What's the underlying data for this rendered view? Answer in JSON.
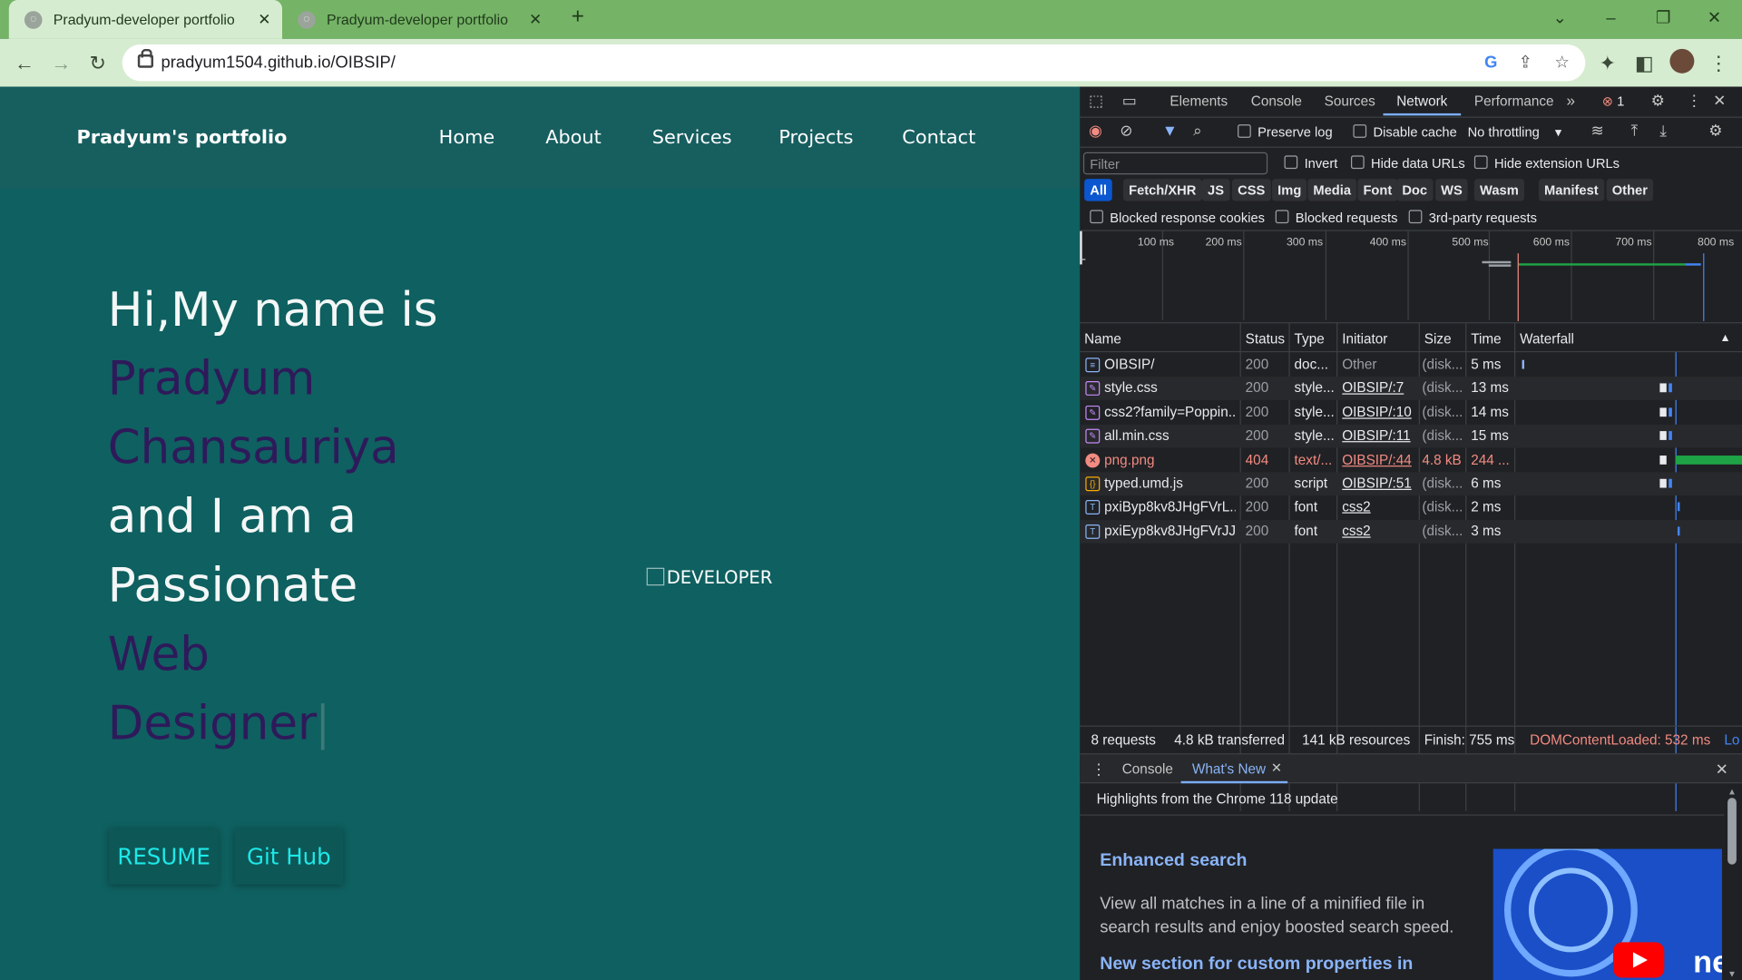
{
  "browser": {
    "tabs": [
      {
        "title": "Pradyum-developer portfolio"
      },
      {
        "title": "Pradyum-developer portfolio"
      }
    ],
    "url": "pradyum1504.github.io/OIBSIP/",
    "new_tab_label": "+"
  },
  "page": {
    "brand": "Pradyum's portfolio",
    "nav": [
      "Home",
      "About",
      "Services",
      "Projects",
      "Contact"
    ],
    "hero_lines": [
      {
        "text": "Hi,My name is",
        "color": "#f4f7f7"
      },
      {
        "text": "Pradyum",
        "color": "#2e1a5a"
      },
      {
        "text": "Chansauriya",
        "color": "#2e1a5a"
      },
      {
        "text": "and I am a",
        "color": "#f4f7f7"
      },
      {
        "text": "Passionate",
        "color": "#f4f7f7"
      },
      {
        "text": "Web",
        "color": "#2e1a5a"
      },
      {
        "text": "Designer",
        "color": "#2e1a5a"
      }
    ],
    "image_alt": "DEVELOPER",
    "buttons": [
      "RESUME",
      "Git Hub"
    ]
  },
  "devtools": {
    "tabs": [
      "Elements",
      "Console",
      "Sources",
      "Network",
      "Performance"
    ],
    "active_tab": "Network",
    "error_count": "1",
    "toolbar": {
      "preserve_log": "Preserve log",
      "disable_cache": "Disable cache",
      "throttling": "No throttling"
    },
    "filter": {
      "placeholder": "Filter",
      "invert": "Invert",
      "hide_data_urls": "Hide data URLs",
      "hide_extension_urls": "Hide extension URLs"
    },
    "type_chips": [
      "All",
      "Fetch/XHR",
      "JS",
      "CSS",
      "Img",
      "Media",
      "Font",
      "Doc",
      "WS",
      "Wasm",
      "Manifest",
      "Other"
    ],
    "more_filters": [
      "Blocked response cookies",
      "Blocked requests",
      "3rd-party requests"
    ],
    "timeline_ticks": [
      "100 ms",
      "200 ms",
      "300 ms",
      "400 ms",
      "500 ms",
      "600 ms",
      "700 ms",
      "800 ms"
    ],
    "columns": [
      "Name",
      "Status",
      "Type",
      "Initiator",
      "Size",
      "Time",
      "Waterfall"
    ],
    "requests": [
      {
        "name": "OIBSIP/",
        "status": "200",
        "type": "doc...",
        "initiator": "Other",
        "size": "(disk...",
        "time": "5 ms",
        "error": false,
        "icon": "document-icon"
      },
      {
        "name": "style.css",
        "status": "200",
        "type": "style...",
        "initiator": "OIBSIP/:7",
        "size": "(disk...",
        "time": "13 ms",
        "error": false,
        "icon": "stylesheet-icon"
      },
      {
        "name": "css2?family=Poppin...",
        "status": "200",
        "type": "style...",
        "initiator": "OIBSIP/:10",
        "size": "(disk...",
        "time": "14 ms",
        "error": false,
        "icon": "stylesheet-icon"
      },
      {
        "name": "all.min.css",
        "status": "200",
        "type": "style...",
        "initiator": "OIBSIP/:11",
        "size": "(disk...",
        "time": "15 ms",
        "error": false,
        "icon": "stylesheet-icon"
      },
      {
        "name": "png.png",
        "status": "404",
        "type": "text/...",
        "initiator": "OIBSIP/:44",
        "size": "4.8 kB",
        "time": "244 ...",
        "error": true,
        "icon": "error-icon"
      },
      {
        "name": "typed.umd.js",
        "status": "200",
        "type": "script",
        "initiator": "OIBSIP/:51",
        "size": "(disk...",
        "time": "6 ms",
        "error": false,
        "icon": "script-icon"
      },
      {
        "name": "pxiByp8kv8JHgFVrL...",
        "status": "200",
        "type": "font",
        "initiator": "css2",
        "size": "(disk...",
        "time": "2 ms",
        "error": false,
        "icon": "font-icon"
      },
      {
        "name": "pxiEyp8kv8JHgFVrJJ...",
        "status": "200",
        "type": "font",
        "initiator": "css2",
        "size": "(disk...",
        "time": "3 ms",
        "error": false,
        "icon": "font-icon"
      }
    ],
    "summary": {
      "requests": "8 requests",
      "transferred": "4.8 kB transferred",
      "resources": "141 kB resources",
      "finish": "Finish: 755 ms",
      "dcl": "DOMContentLoaded: 532 ms",
      "load_trunc": "Lo"
    },
    "drawer": {
      "tabs": [
        "Console",
        "What's New"
      ],
      "active": "What's New",
      "header": "Highlights from the Chrome 118 update",
      "item1_title": "Enhanced search",
      "item1_desc": "View all matches in a line of a minified file in search results and enjoy boosted search speed.",
      "item2_title": "New section for custom properties in"
    }
  }
}
